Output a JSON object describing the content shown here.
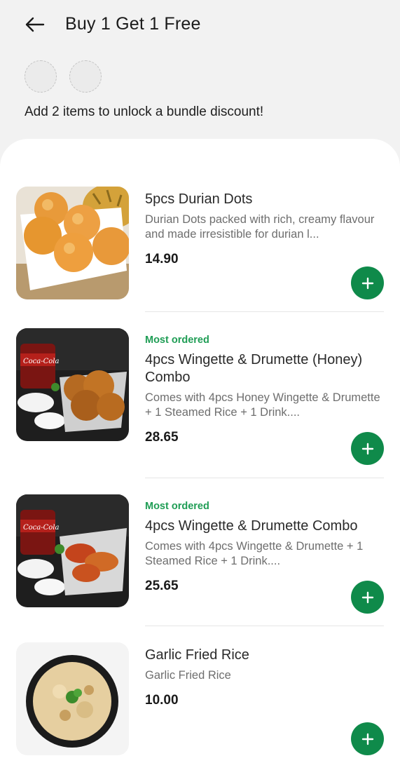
{
  "header": {
    "title": "Buy 1 Get 1 Free"
  },
  "bundle": {
    "hint": "Add 2 items to unlock a bundle discount!"
  },
  "items": [
    {
      "badge": "",
      "name": "5pcs Durian Dots",
      "description": "Durian Dots packed with rich, creamy flavour and made irresistible for durian l...",
      "price": "14.90"
    },
    {
      "badge": "Most ordered",
      "name": "4pcs Wingette & Drumette (Honey) Combo",
      "description": "Comes with 4pcs Honey Wingette & Drumette + 1 Steamed Rice + 1 Drink....",
      "price": "28.65"
    },
    {
      "badge": "Most ordered",
      "name": "4pcs Wingette & Drumette Combo",
      "description": "Comes with 4pcs Wingette & Drumette + 1 Steamed Rice + 1 Drink....",
      "price": "25.65"
    },
    {
      "badge": "",
      "name": "Garlic Fried Rice",
      "description": "Garlic Fried Rice",
      "price": "10.00"
    }
  ],
  "colors": {
    "accent": "#0f8a4a",
    "badge": "#1f9d55",
    "background": "#f2f2f2"
  },
  "icons": {
    "back": "arrow-left-icon",
    "add": "plus-icon"
  }
}
